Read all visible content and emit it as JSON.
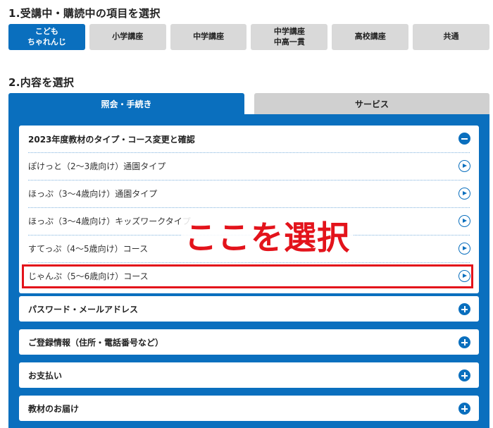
{
  "section1": {
    "heading": "1.受講中・購読中の項目を選択"
  },
  "course_tabs": [
    {
      "label": "こども\nちゃれんじ",
      "active": true
    },
    {
      "label": "小学講座",
      "active": false
    },
    {
      "label": "中学講座",
      "active": false
    },
    {
      "label": "中学講座\n中高一貫",
      "active": false
    },
    {
      "label": "高校講座",
      "active": false
    },
    {
      "label": "共通",
      "active": false
    }
  ],
  "section2": {
    "heading": "2.内容を選択"
  },
  "content_tabs": {
    "inquiry": "照会・手続き",
    "service": "サービス"
  },
  "open_accordion": {
    "title": "2023年度教材のタイプ・コース変更と確認",
    "items": [
      "ぽけっと（2〜3歳向け）通園タイプ",
      "ほっぷ（3〜4歳向け）通園タイプ",
      "ほっぷ（3〜4歳向け）キッズワークタイプ",
      "すてっぷ（4〜5歳向け）コース",
      "じゃんぷ（5〜6歳向け）コース"
    ]
  },
  "closed_accordions": [
    "パスワード・メールアドレス",
    "ご登録情報（住所・電話番号など）",
    "お支払い",
    "教材のお届け"
  ],
  "annotation": {
    "text": "ここを選択",
    "color": "#e3131b"
  },
  "colors": {
    "brand_blue": "#0a6fbe",
    "inactive_tab": "#d9d9d9"
  }
}
